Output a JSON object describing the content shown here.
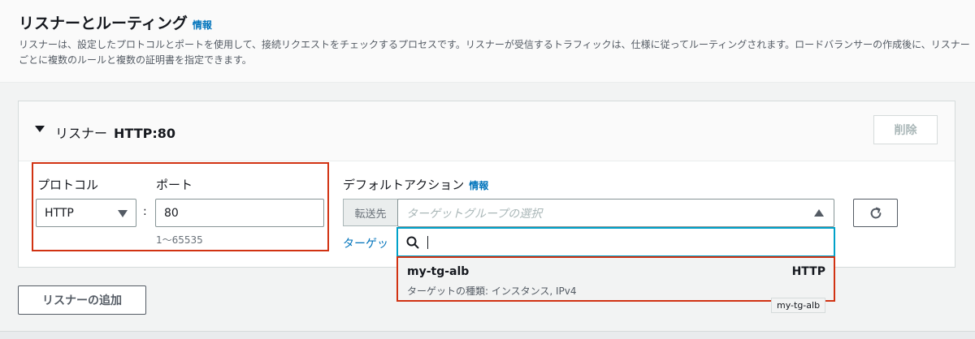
{
  "section": {
    "title": "リスナーとルーティング",
    "info_label": "情報",
    "description": "リスナーは、設定したプロトコルとポートを使用して、接続リクエストをチェックするプロセスです。リスナーが受信するトラフィックは、仕様に従ってルーティングされます。ロードバランサーの作成後に、リスナーごとに複数のルールと複数の証明書を指定できます。"
  },
  "listener": {
    "label": "リスナー",
    "name": "HTTP:80",
    "delete_label": "削除",
    "protocol_label": "プロトコル",
    "protocol_value": "HTTP",
    "separator": ":",
    "port_label": "ポート",
    "port_value": "80",
    "port_hint": "1〜65535",
    "default_action_label": "デフォルトアクション",
    "default_action_info": "情報",
    "forward_to_label": "転送先",
    "target_group_placeholder": "ターゲットグループの選択",
    "target_link_partial": "ターゲッ",
    "search_value": "",
    "option": {
      "name": "my-tg-alb",
      "protocol": "HTTP",
      "detail": "ターゲットの種類: インスタンス, IPv4"
    },
    "tooltip": "my-tg-alb"
  },
  "add_listener_label": "リスナーの追加",
  "icons": {
    "expand": "caret-down-icon",
    "protocol_dropdown": "caret-down-icon",
    "target_dropdown": "caret-up-icon",
    "search": "search-icon",
    "refresh": "refresh-icon"
  },
  "colors": {
    "accent": "#0073bb",
    "highlight_border": "#d13212",
    "focus_border": "#00a1c9"
  }
}
